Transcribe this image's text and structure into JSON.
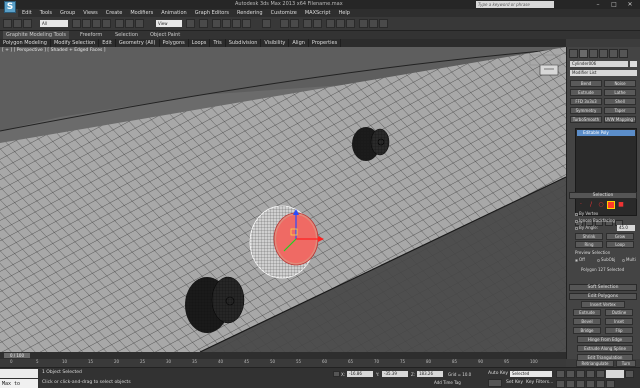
{
  "window": {
    "title": "Autodesk 3ds Max 2013 x64    Filename.max",
    "search_placeholder": "Type a keyword or phrase",
    "min": "–",
    "max": "□",
    "close": "✕"
  },
  "menu": [
    "Edit",
    "Tools",
    "Group",
    "Views",
    "Create",
    "Modifiers",
    "Animation",
    "Graph Editors",
    "Rendering",
    "Customize",
    "MAXScript",
    "Help"
  ],
  "toolbar": {
    "selection_filter": "All",
    "reference_coord": "View"
  },
  "ribbon": {
    "tabs": [
      "Graphite Modeling Tools",
      "Freeform",
      "Selection",
      "Object Paint"
    ],
    "sub_tabs": [
      "Polygon Modeling",
      "Modify Selection",
      "Edit",
      "Geometry (All)",
      "Polygons",
      "Loops",
      "Tris",
      "Subdivision",
      "Visibility",
      "Align",
      "Properties"
    ]
  },
  "viewport": {
    "label": "[ + ] [ Perspective ] [ Shaded + Edged Faces ]"
  },
  "command_panel": {
    "object_name": "Cylinder006",
    "modifier_list": "Modifier List",
    "mod_buttons": [
      "Bend",
      "Noise",
      "Extrude",
      "Lathe",
      "FFD 3x3x3",
      "Shell",
      "Symmetry",
      "Taper",
      "TurboSmooth",
      "UVW Mapping Clr"
    ],
    "stack_item": "Editable Poly",
    "selection": {
      "header": "Selection",
      "by_vertex": "By Vertex",
      "ignore_backfacing": "Ignore Backfacing",
      "by_angle": "By Angle:",
      "angle_value": "45.0",
      "shrink": "Shrink",
      "grow": "Grow",
      "ring": "Ring",
      "loop": "Loop",
      "preview_selection": "Preview Selection",
      "off": "Off",
      "subobj": "SubObj",
      "multi": "Multi",
      "status": "Polygon 127 Selected"
    },
    "soft_selection": "Soft Selection",
    "edit_polygons": {
      "header": "Edit Polygons",
      "insert_vertex": "Insert Vertex",
      "extrude": "Extrude",
      "outline": "Outline",
      "bevel": "Bevel",
      "inset": "Inset",
      "bridge": "Bridge",
      "flip": "Flip",
      "hinge_from_edge": "Hinge From Edge",
      "extrude_along_spline": "Extrude Along Spline",
      "edit_triangulation": "Edit Triangulation",
      "retriangulate": "Retriangulate",
      "turn": "Turn"
    }
  },
  "timeline": {
    "frame": "0 / 100",
    "ticks": [
      "0",
      "5",
      "10",
      "15",
      "20",
      "25",
      "30",
      "35",
      "40",
      "45",
      "50",
      "55",
      "60",
      "65",
      "70",
      "75",
      "80",
      "85",
      "90",
      "95",
      "100"
    ]
  },
  "status": {
    "maxscript": "Max to Physc",
    "objects_selected": "1 Object Selected",
    "prompt": "Click or click-and-drag to select objects",
    "x_label": "X:",
    "x": "-16.86",
    "y_label": "Y:",
    "y": "-35.39",
    "z_label": "Z:",
    "z": "183.26",
    "grid": "Grid = 10.0",
    "auto_key": "Auto Key",
    "set_key": "Set Key",
    "selected": "Selected",
    "key_filters": "Key Filters...",
    "add_time_tag": "Add Time Tag"
  }
}
